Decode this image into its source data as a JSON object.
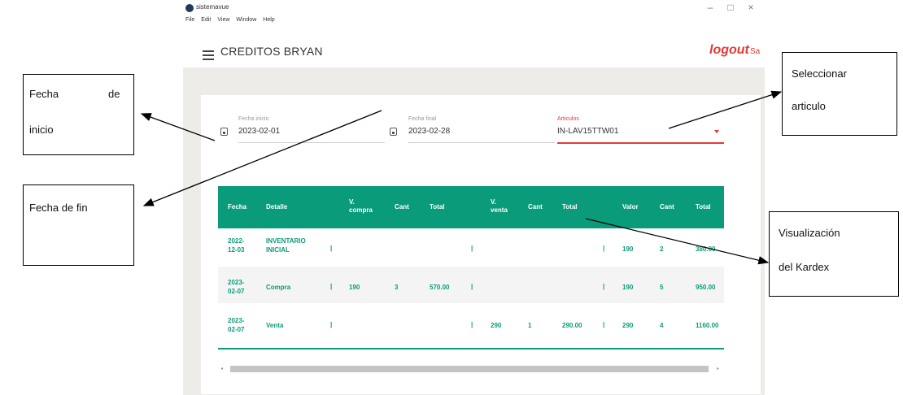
{
  "app": {
    "title": "sistemavue",
    "window_controls": {
      "minimize": "–",
      "maximize": "□",
      "close": "×"
    },
    "menu": [
      "File",
      "Edit",
      "View",
      "Window",
      "Help"
    ]
  },
  "header": {
    "title": "CREDITOS BRYAN",
    "logout": "logout",
    "logout_tail": "Sa"
  },
  "filters": {
    "start": {
      "label": "Fecha inicio",
      "value": "2023-02-01"
    },
    "end": {
      "label": "Fecha final",
      "value": "2023-02-28"
    },
    "article": {
      "label": "Articulos",
      "value": "IN-LAV15TTW01"
    }
  },
  "table": {
    "headers": [
      "Fecha",
      "Detalle",
      "V. compra",
      "Cant",
      "Total",
      "V. venta",
      "Cant",
      "Total",
      "Valor",
      "Cant",
      "Total"
    ],
    "rows": [
      {
        "fecha": "2022-12-03",
        "detalle": "INVENTARIO INICIAL",
        "v_compra": "",
        "cant_c": "",
        "total_c": "",
        "v_venta": "",
        "cant_v": "",
        "total_v": "",
        "valor": "190",
        "cant": "2",
        "total": "380.00"
      },
      {
        "fecha": "2023-02-07",
        "detalle": "Compra",
        "v_compra": "190",
        "cant_c": "3",
        "total_c": "570.00",
        "v_venta": "",
        "cant_v": "",
        "total_v": "",
        "valor": "190",
        "cant": "5",
        "total": "950.00"
      },
      {
        "fecha": "2023-02-07",
        "detalle": "Venta",
        "v_compra": "",
        "cant_c": "",
        "total_c": "",
        "v_venta": "290",
        "cant_v": "1",
        "total_v": "290.00",
        "valor": "290",
        "cant": "4",
        "total": "1160.00"
      }
    ],
    "separator": "|",
    "row_backgrounds": [
      "#ffffff",
      "#f4f4f4",
      "#ffffff"
    ]
  },
  "annotations": {
    "fecha_inicio": {
      "word1": "Fecha",
      "word2": "de",
      "word3": "inicio"
    },
    "fecha_fin": "Fecha de fin",
    "seleccionar": {
      "line1": "Seleccionar",
      "line2": "articulo"
    },
    "visualizacion": {
      "line1": "Visualización",
      "line2": "del Kardex"
    }
  },
  "colors": {
    "accent": "#0a9c7a",
    "logout": "#e53935",
    "background": "#eeece8"
  }
}
